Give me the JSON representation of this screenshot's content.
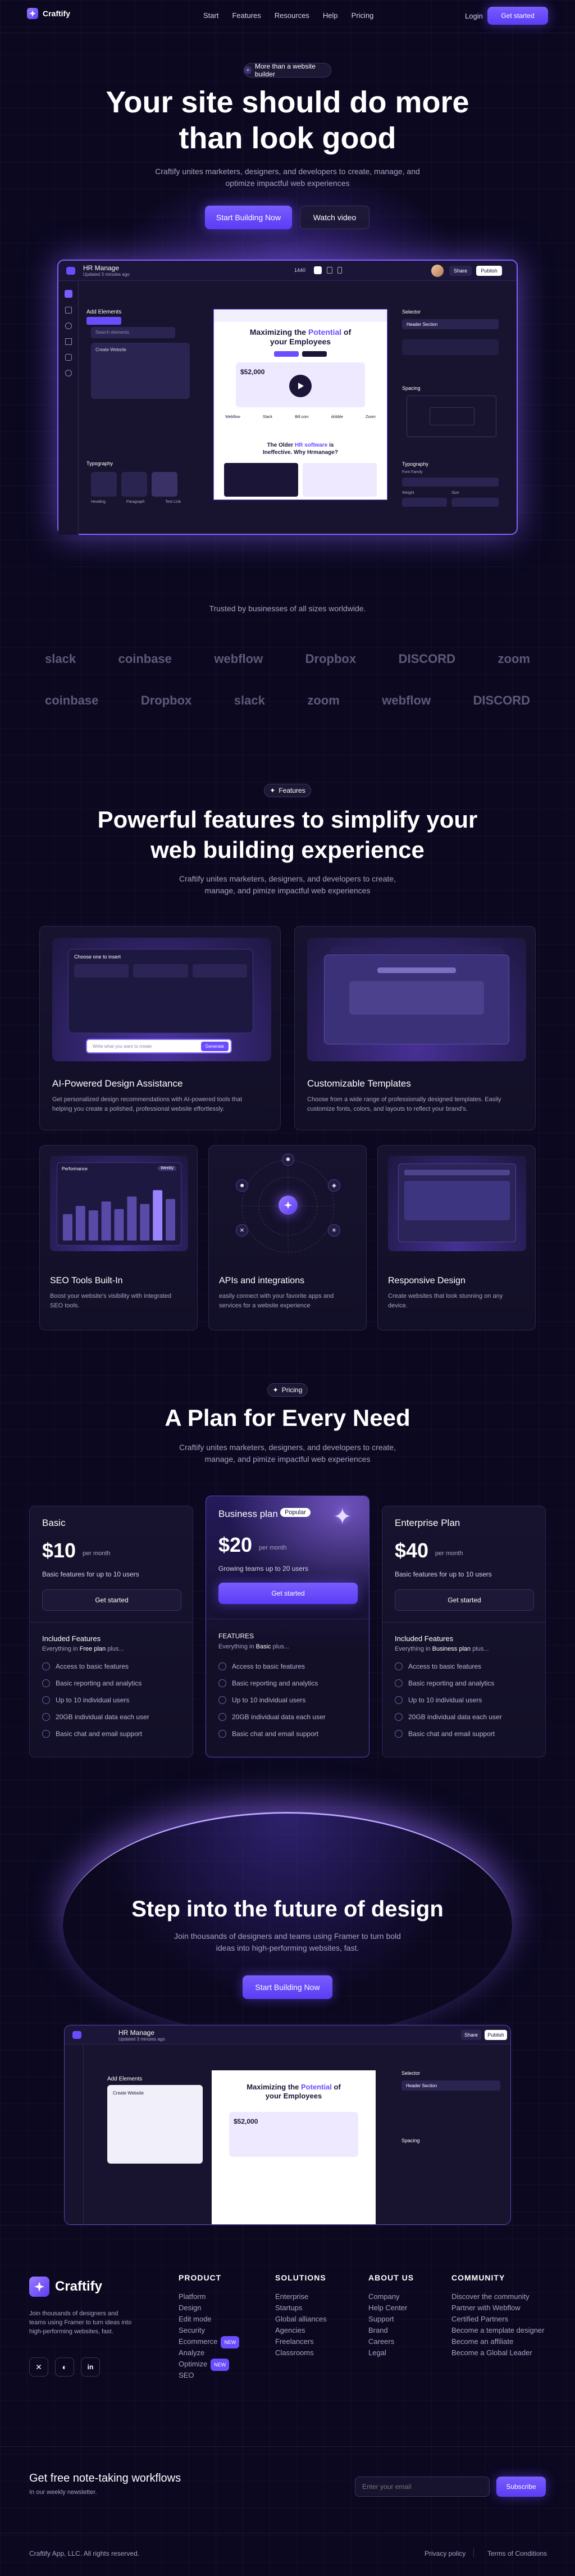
{
  "brand": {
    "name": "Craftify"
  },
  "nav": {
    "links": [
      "Start",
      "Features",
      "Resources",
      "Help",
      "Pricing"
    ],
    "login": "Login",
    "cta": "Get started"
  },
  "hero": {
    "badge": "More than a website builder",
    "title_line1": "Your site should do more",
    "title_line2": "than look good",
    "subtitle_line1": "Craftify unites marketers, designers, and developers to create, manage, and",
    "subtitle_line2": "optimize impactful web experiences",
    "primary": "Start Building Now",
    "secondary": "Watch video"
  },
  "mockup": {
    "title": "HR Manage",
    "subtitle": "Updated 3 minutes ago",
    "elements_label": "Add Elements",
    "search_placeholder": "Search elements",
    "create_label": "Create Website",
    "typography_label": "Typography",
    "type_items": [
      "Heading",
      "Paragraph",
      "Text Link"
    ],
    "tablet_label": "1440",
    "toolbar_publish": "Publish",
    "toolbar_share": "Share",
    "canvas_headline_1": "Maximizing the",
    "canvas_headline_accent": "Potential",
    "canvas_headline_2": "of",
    "canvas_headline_3": "your Employees",
    "canvas_stat": "$52,000",
    "canvas_bottom_1": "The Older",
    "canvas_bottom_accent": "HR software",
    "canvas_bottom_2": "is",
    "canvas_bottom_3": "Ineffective. Why Hrmanage?",
    "selector_label": "Selector",
    "selector_value": "Header Section",
    "spacing_label": "Spacing",
    "right_typography": "Typography",
    "font_family": "Font Family",
    "weight": "Weight",
    "size": "Size",
    "canvas_logos": [
      "Webflow",
      "Slack",
      "Bill.com",
      "dribble",
      "Zoom"
    ]
  },
  "trusted": {
    "text": "Trusted by businesses of all sizes worldwide.",
    "row1": [
      "slack",
      "coinbase",
      "webflow",
      "Dropbox",
      "DISCORD",
      "zoom"
    ],
    "row2": [
      "coinbase",
      "Dropbox",
      "slack",
      "zoom",
      "webflow",
      "DISCORD"
    ]
  },
  "features": {
    "badge": "Features",
    "title_line1": "Powerful features to simplify your",
    "title_line2": "web building experience",
    "subtitle_line1": "Craftify unites marketers, designers, and developers to create,",
    "subtitle_line2": "manage, and pimize impactful web experiences",
    "ai": {
      "title": "AI-Powered Design Assistance",
      "desc_line1": "Get personalized design recommendations with AI-powered tools that",
      "desc_line2": "helping you create a polished, professional website effortlessly.",
      "panel_title": "Choose one to insert",
      "input_placeholder": "Write what you want to create",
      "generate": "Generate"
    },
    "templates": {
      "title": "Customizable Templates",
      "desc_line1": "Choose from a wide range of professionally designed templates. Easily",
      "desc_line2": "customize fonts, colors, and layouts to reflect your brand's."
    },
    "seo": {
      "title": "SEO Tools Built-In",
      "desc_line1": "Boost your website's visibility with integrated",
      "desc_line2": "SEO tools.",
      "panel_title": "Performance",
      "panel_pill": "Weekly"
    },
    "apis": {
      "title": "APIs and integrations",
      "desc_line1": "easily connect with your favorite apps and",
      "desc_line2": "services for a website experience"
    },
    "responsive": {
      "title": "Responsive Design",
      "desc_line1": "Create websites that look stunning on any",
      "desc_line2": "device."
    },
    "seo_bars": [
      0.42,
      0.55,
      0.48,
      0.62,
      0.5,
      0.7,
      0.58,
      0.8,
      0.66
    ]
  },
  "pricing": {
    "badge": "Pricing",
    "title": "A Plan for Every Need",
    "subtitle_line1": "Craftify unites marketers, designers, and developers to create,",
    "subtitle_line2": "manage, and pimize impactful web experiences",
    "plans": [
      {
        "name": "Basic",
        "price": "$10",
        "period": "per month",
        "note": "Basic features for up to 10 users",
        "cta": "Get started",
        "included_title": "Included Features",
        "everything": "Everything in",
        "everything_bold": "Free plan",
        "features": [
          "Access to basic features",
          "Basic reporting and analytics",
          "Up to 10 individual users",
          "20GB individual data each user",
          "Basic chat and email support"
        ]
      },
      {
        "name": "Business plan",
        "badge": "Popular",
        "price": "$20",
        "period": "per month",
        "note": "Growing teams up to 20 users",
        "cta": "Get started",
        "included_title": "FEATURES",
        "everything": "Everything in",
        "everything_bold": "Basic",
        "features": [
          "Access to basic features",
          "Basic reporting and analytics",
          "Up to 10 individual users",
          "20GB individual data each user",
          "Basic chat and email support"
        ]
      },
      {
        "name": "Enterprise Plan",
        "price": "$40",
        "period": "per month",
        "note": "Basic features for up to 10 users",
        "cta": "Get started",
        "included_title": "Included Features",
        "everything": "Everything in",
        "everything_bold": "Business plan",
        "features": [
          "Access to basic features",
          "Basic reporting and analytics",
          "Up to 10 individual users",
          "20GB individual data each user",
          "Basic chat and email support"
        ]
      }
    ]
  },
  "cta2": {
    "title": "Step into the future of design",
    "subtitle_line1": "Join thousands of designers and teams using Framer to turn bold",
    "subtitle_line2": "ideas into high-performing websites, fast.",
    "button": "Start Building Now"
  },
  "footer": {
    "desc_line1": "Join thousands of designers and",
    "desc_line2": "teams using Framer to turn ideas into",
    "desc_line3": "high-performing websites, fast.",
    "cols": [
      {
        "title": "PRODUCT",
        "links": [
          "Platform",
          "Design",
          "Edit mode",
          "Security",
          "Ecommerce",
          "Analyze",
          "Optimize",
          "SEO"
        ]
      },
      {
        "title": "SOLUTIONS",
        "links": [
          "Enterprise",
          "Startups",
          "Global alliances",
          "Agencies",
          "Freelancers",
          "Classrooms"
        ]
      },
      {
        "title": "ABOUT US",
        "links": [
          "Company",
          "Help Center",
          "Support",
          "Brand",
          "Careers",
          "Legal"
        ]
      },
      {
        "title": "COMMUNITY",
        "links": [
          "Discover the community",
          "Partner with Webflow",
          "Certified Partners",
          "Become a template designer",
          "Become an affiliate",
          "Become a Global Leader"
        ]
      }
    ],
    "new_tag": "NEW",
    "newsletter_title": "Get free note-taking workflows",
    "newsletter_sub": "In our weekly newsletter.",
    "email_placeholder": "Enter your email",
    "subscribe": "Subscribe",
    "copyright": "Craftify App, LLC. All rights reserved.",
    "privacy": "Privacy policy",
    "terms": "Terms of Conditions"
  }
}
